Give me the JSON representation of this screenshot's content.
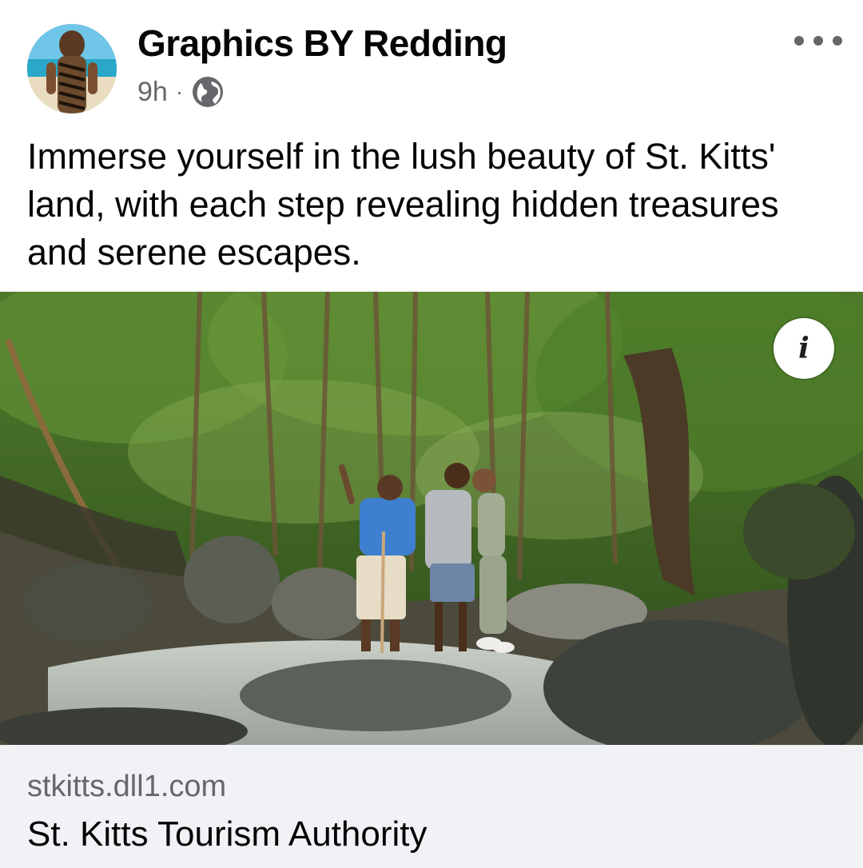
{
  "post": {
    "author": "Graphics BY Redding",
    "time": "9h",
    "separator": "·",
    "audience_icon": "globe-icon",
    "more_icon": "more-horizontal-icon",
    "text": "Immerse yourself in the lush beauty of St. Kitts' land, with each step revealing hidden treasures and serene escapes."
  },
  "image": {
    "info_glyph": "i",
    "info_icon": "info-icon"
  },
  "link": {
    "domain": "stkitts.dll1.com",
    "title": "St. Kitts Tourism Authority"
  },
  "colors": {
    "text_primary": "#050505",
    "text_secondary": "#65676b",
    "preview_background": "#f0f2f5"
  }
}
